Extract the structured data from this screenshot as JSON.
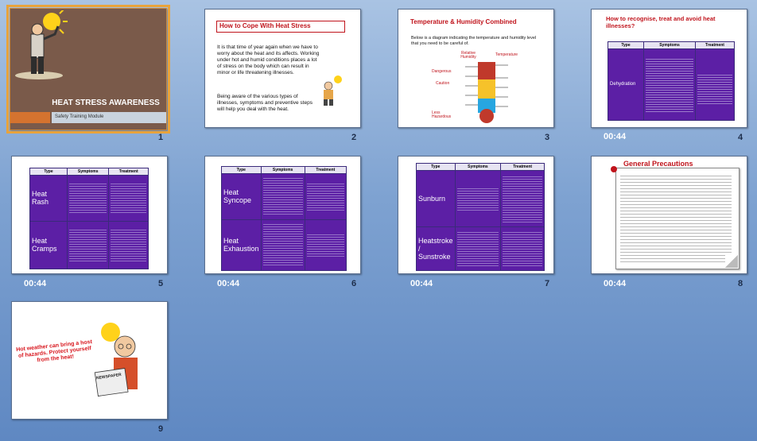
{
  "slides": [
    {
      "number": "1",
      "time": "",
      "title": "HEAT STRESS AWARENESS",
      "subtitle": "Safety Training Module",
      "selected": true
    },
    {
      "number": "2",
      "time": "",
      "title": "How to Cope With Heat Stress",
      "para1": "It is that time of year again when we have to worry about the heat and its affects.  Working under hot and humid conditions places a lot of stress on the body which can result in minor or life threatening illnesses.",
      "para2": "Being aware of the various types of illnesses, symptoms and preventive steps will help you deal with the heat."
    },
    {
      "number": "3",
      "time": "",
      "title": "Temperature & Humidity Combined",
      "body": "Below is a diagram indicating the temperature and humidity level that you need to be careful of.",
      "label_rh": "Relative Humidity",
      "label_temp": "Temperature",
      "zones": [
        "Dangerous",
        "Caution",
        "Less Hazardous"
      ]
    },
    {
      "number": "4",
      "time": "00:44",
      "title": "How to recognise, treat and avoid heat illnesses?",
      "headers": [
        "Type",
        "Symptoms",
        "Treatment"
      ],
      "rows": [
        {
          "type": "Dehydration"
        }
      ]
    },
    {
      "number": "5",
      "time": "00:44",
      "headers": [
        "Type",
        "Symptoms",
        "Treatment"
      ],
      "rows": [
        {
          "type": "Heat Rash"
        },
        {
          "type": "Heat Cramps"
        }
      ]
    },
    {
      "number": "6",
      "time": "00:44",
      "headers": [
        "Type",
        "Symptoms",
        "Treatment"
      ],
      "rows": [
        {
          "type": "Heat Syncope"
        },
        {
          "type": "Heat Exhaustion"
        }
      ]
    },
    {
      "number": "7",
      "time": "00:44",
      "headers": [
        "Type",
        "Symptoms",
        "Treatment"
      ],
      "rows": [
        {
          "type": "Sunburn"
        },
        {
          "type": "Heatstroke / Sunstroke"
        }
      ]
    },
    {
      "number": "8",
      "time": "00:44",
      "title": "General Precautions"
    },
    {
      "number": "9",
      "time": "",
      "text": "Hot weather can bring a host of hazards. Protect yourself from the heat!",
      "newspaper": "NEWSPAPER"
    }
  ],
  "colors": {
    "table_purple": "#5c1fa5",
    "title_red": "#c0141c",
    "slide1_bg": "#7a5a4a",
    "slide1_bar": "#d5732f",
    "selection": "#e8a33c"
  }
}
